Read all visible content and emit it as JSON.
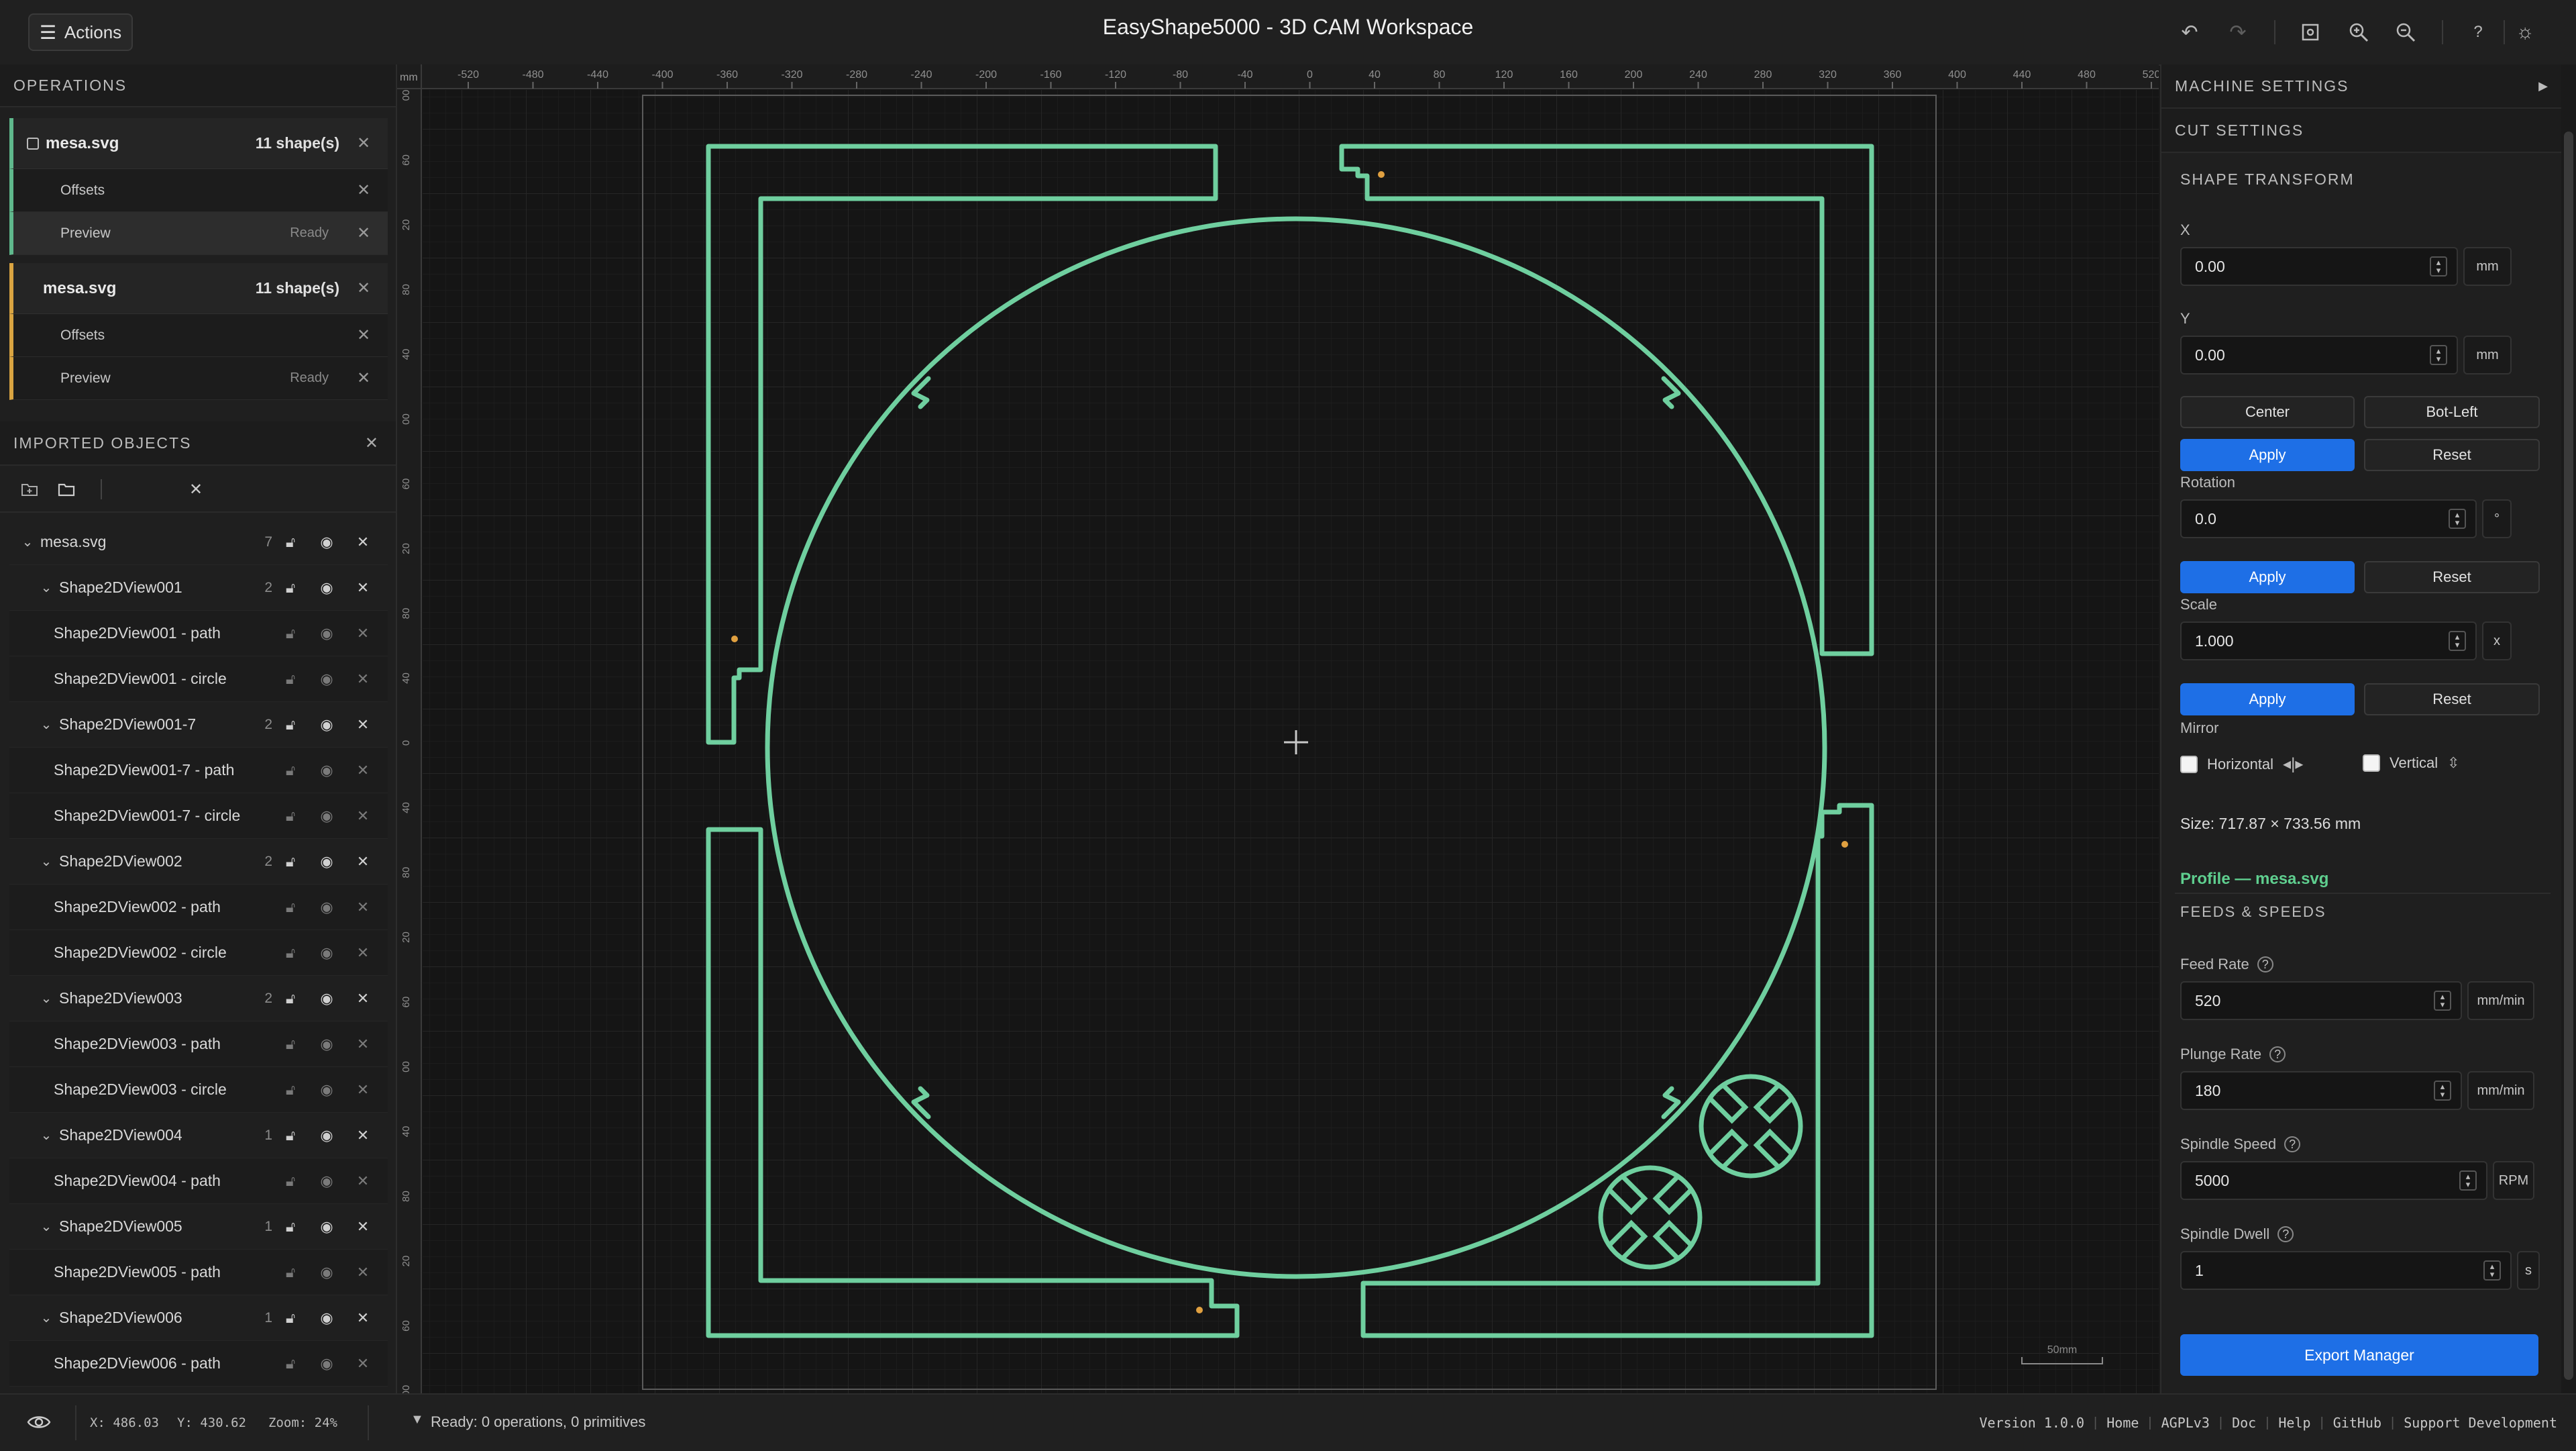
{
  "topbar": {
    "actions_label": "Actions",
    "title": "EasyShape5000 - 3D CAM Workspace"
  },
  "operations": {
    "header": "OPERATIONS",
    "groups": [
      {
        "name": "mesa.svg",
        "count": "11 shape(s)",
        "accent": "#5fb88c",
        "children": [
          {
            "name": "Offsets",
            "status": ""
          },
          {
            "name": "Preview",
            "status": "Ready"
          }
        ]
      },
      {
        "name": "mesa.svg",
        "count": "11 shape(s)",
        "accent": "#d9a441",
        "children": [
          {
            "name": "Offsets",
            "status": ""
          },
          {
            "name": "Preview",
            "status": "Ready"
          }
        ]
      }
    ]
  },
  "imported": {
    "header": "IMPORTED OBJECTS",
    "tree": [
      {
        "name": "mesa.svg",
        "count": "7",
        "level": 0,
        "group": true
      },
      {
        "name": "Shape2DView001",
        "count": "2",
        "level": 1,
        "group": true
      },
      {
        "name": "Shape2DView001 - path",
        "level": 2
      },
      {
        "name": "Shape2DView001 - circle",
        "level": 2
      },
      {
        "name": "Shape2DView001-7",
        "count": "2",
        "level": 1,
        "group": true
      },
      {
        "name": "Shape2DView001-7 - path",
        "level": 2
      },
      {
        "name": "Shape2DView001-7 - circle",
        "level": 2
      },
      {
        "name": "Shape2DView002",
        "count": "2",
        "level": 1,
        "group": true
      },
      {
        "name": "Shape2DView002 - path",
        "level": 2
      },
      {
        "name": "Shape2DView002 - circle",
        "level": 2
      },
      {
        "name": "Shape2DView003",
        "count": "2",
        "level": 1,
        "group": true
      },
      {
        "name": "Shape2DView003 - path",
        "level": 2
      },
      {
        "name": "Shape2DView003 - circle",
        "level": 2
      },
      {
        "name": "Shape2DView004",
        "count": "1",
        "level": 1,
        "group": true
      },
      {
        "name": "Shape2DView004 - path",
        "level": 2
      },
      {
        "name": "Shape2DView005",
        "count": "1",
        "level": 1,
        "group": true
      },
      {
        "name": "Shape2DView005 - path",
        "level": 2
      },
      {
        "name": "Shape2DView006",
        "count": "1",
        "level": 1,
        "group": true
      },
      {
        "name": "Shape2DView006 - path",
        "level": 2
      }
    ]
  },
  "canvas": {
    "ruler_unit": "mm",
    "ruler_x": [
      "-520",
      "-480",
      "-440",
      "-400",
      "-360",
      "-320",
      "-280",
      "-240",
      "-200",
      "-160",
      "-120",
      "-80",
      "-40",
      "0",
      "40",
      "80",
      "120",
      "160",
      "200",
      "240",
      "280",
      "320",
      "360",
      "400",
      "440",
      "480",
      "520"
    ],
    "ruler_y": [
      "00",
      "60",
      "20",
      "80",
      "40",
      "00",
      "60",
      "20",
      "80",
      "40",
      "0",
      "40",
      "80",
      "20",
      "60",
      "00",
      "40",
      "80",
      "20",
      "60",
      "00"
    ],
    "scale_label": "50mm",
    "shape_color": "#6fcf9f"
  },
  "right": {
    "machine_settings": "MACHINE SETTINGS",
    "cut_settings": "CUT SETTINGS",
    "shape_transform": "SHAPE TRANSFORM",
    "x_label": "X",
    "x_value": "0.00",
    "x_unit": "mm",
    "y_label": "Y",
    "y_value": "0.00",
    "y_unit": "mm",
    "center": "Center",
    "bot_left": "Bot-Left",
    "apply": "Apply",
    "reset": "Reset",
    "rotation_label": "Rotation",
    "rotation_value": "0.0",
    "rotation_unit": "°",
    "scale_label": "Scale",
    "scale_value": "1.000",
    "scale_unit": "x",
    "mirror_label": "Mirror",
    "horizontal": "Horizontal",
    "vertical": "Vertical",
    "size_text": "Size: 717.87 × 733.56 mm",
    "profile_text": "Profile — mesa.svg",
    "feeds_header": "FEEDS & SPEEDS",
    "feed_label": "Feed Rate",
    "feed_value": "520",
    "feed_unit": "mm/min",
    "plunge_label": "Plunge Rate",
    "plunge_value": "180",
    "plunge_unit": "mm/min",
    "spindle_label": "Spindle Speed",
    "spindle_value": "5000",
    "spindle_unit": "RPM",
    "dwell_label": "Spindle Dwell",
    "dwell_value": "1",
    "dwell_unit": "s",
    "export": "Export Manager",
    "accent": "#1e6fe6",
    "profile_color": "#5fcf8f"
  },
  "status": {
    "x": "X: 486.03",
    "y": "Y: 430.62",
    "zoom": "Zoom: 24%",
    "ready": "Ready: 0 operations, 0 primitives",
    "version": "Version 1.0.0",
    "links": [
      "Home",
      "AGPLv3",
      "Doc",
      "Help",
      "GitHub",
      "Support Development"
    ]
  }
}
